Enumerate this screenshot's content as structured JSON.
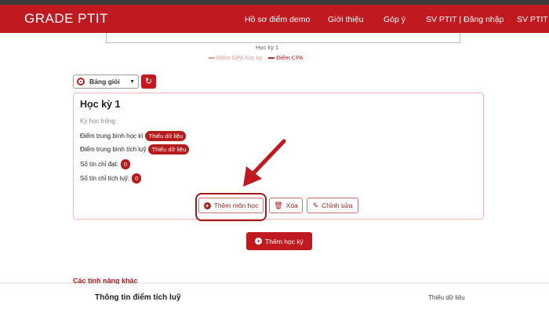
{
  "navbar": {
    "brand": "GRADE PTIT",
    "items": [
      "Hồ sơ điểm demo",
      "Giới thiệu",
      "Góp ý",
      "SV PTIT | Đăng nhập",
      "SV PTIT | Đ"
    ]
  },
  "chart": {
    "x_tick": "Học kỳ 1",
    "legend": [
      "Điểm GPA học kỳ",
      "Điểm CPA"
    ],
    "colors": {
      "gpa": "#e79a9a",
      "cpa": "#b22a2a"
    }
  },
  "rank_select": {
    "value": "Bảng giỏi"
  },
  "term_card": {
    "title": "Học kỳ 1",
    "empty": "Kỳ học trống",
    "stats": [
      {
        "label": "Điểm trung bình học kì",
        "value": "Thiếu dữ liệu"
      },
      {
        "label": "Điểm trung bình tích luỹ",
        "value": "Thiếu dữ liệu"
      },
      {
        "label": "Số tín chỉ đạt:",
        "value": "0"
      },
      {
        "label": "Số tín chỉ tích luỹ:",
        "value": "0"
      }
    ],
    "buttons": {
      "add_subject": "Thêm môn học",
      "delete": "Xóa",
      "edit": "Chỉnh sửa"
    }
  },
  "add_term_button": "Thêm học kỳ",
  "features_title": "Các tính năng khác",
  "bottom": {
    "label": "Thông tin điểm tích luỹ",
    "value": "Thiếu dữ liệu"
  },
  "accent": "#c0191f"
}
